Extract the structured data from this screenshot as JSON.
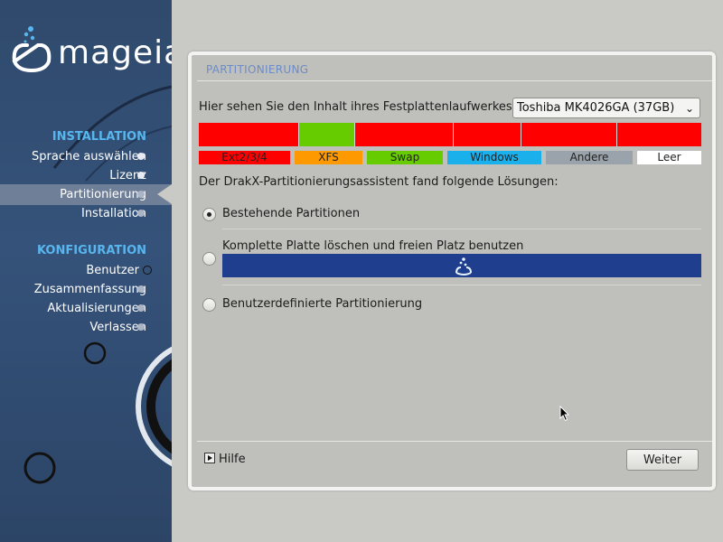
{
  "brand": {
    "name": "mageia"
  },
  "sidebar": {
    "sections": [
      {
        "title": "INSTALLATION",
        "items": [
          {
            "label": "Sprache auswählen",
            "state": "done"
          },
          {
            "label": "Lizenz",
            "state": "done"
          },
          {
            "label": "Partitionierung",
            "state": "active"
          },
          {
            "label": "Installation",
            "state": "pending"
          }
        ]
      },
      {
        "title": "KONFIGURATION",
        "items": [
          {
            "label": "Benutzer",
            "state": "ring"
          },
          {
            "label": "Zusammenfassung",
            "state": "pending"
          },
          {
            "label": "Aktualisierungen",
            "state": "pending"
          },
          {
            "label": "Verlassen",
            "state": "pending"
          }
        ]
      }
    ]
  },
  "main": {
    "title": "PARTITIONIERUNG",
    "disk_label": "Hier sehen Sie den Inhalt ihres Festplattenlaufwerkes",
    "disk_select": "Toshiba MK4026GA (37GB)",
    "partitions": [
      {
        "type": "Ext2/3/4",
        "color": "#ff0000"
      },
      {
        "type": "Swap",
        "color": "#66cc00"
      },
      {
        "type": "Ext2/3/4",
        "color": "#ff0000"
      },
      {
        "type": "Ext2/3/4",
        "color": "#ff0000"
      },
      {
        "type": "Ext2/3/4",
        "color": "#ff0000"
      },
      {
        "type": "Ext2/3/4",
        "color": "#ff0000"
      }
    ],
    "legend": [
      {
        "label": "Ext2/3/4",
        "color": "#ff0000",
        "text_color": "#222222"
      },
      {
        "label": "XFS",
        "color": "#ff9900",
        "text_color": "#222222"
      },
      {
        "label": "Swap",
        "color": "#66cc00",
        "text_color": "#222222"
      },
      {
        "label": "Windows",
        "color": "#1ab0ec",
        "text_color": "#222222"
      },
      {
        "label": "Andere",
        "color": "#9aa3ab",
        "text_color": "#222222"
      },
      {
        "label": "Leer",
        "color": "#ffffff",
        "text_color": "#222222"
      }
    ],
    "found_text": "Der DrakX-Partitionierungsassistent fand folgende Lösungen:",
    "options": [
      {
        "label": "Bestehende Partitionen",
        "checked": true
      },
      {
        "label": "Komplette Platte löschen und freien Platz benutzen",
        "checked": false
      },
      {
        "label": "Benutzerdefinierte Partitionierung",
        "checked": false
      }
    ],
    "fullbar_color": "#1f3f8e",
    "help_label": "Hilfe",
    "next_label": "Weiter"
  },
  "colors": {
    "accent": "#58b6ee",
    "title_blue": "#6c8cc8",
    "sidebar_bg": "#2f4a6c"
  }
}
